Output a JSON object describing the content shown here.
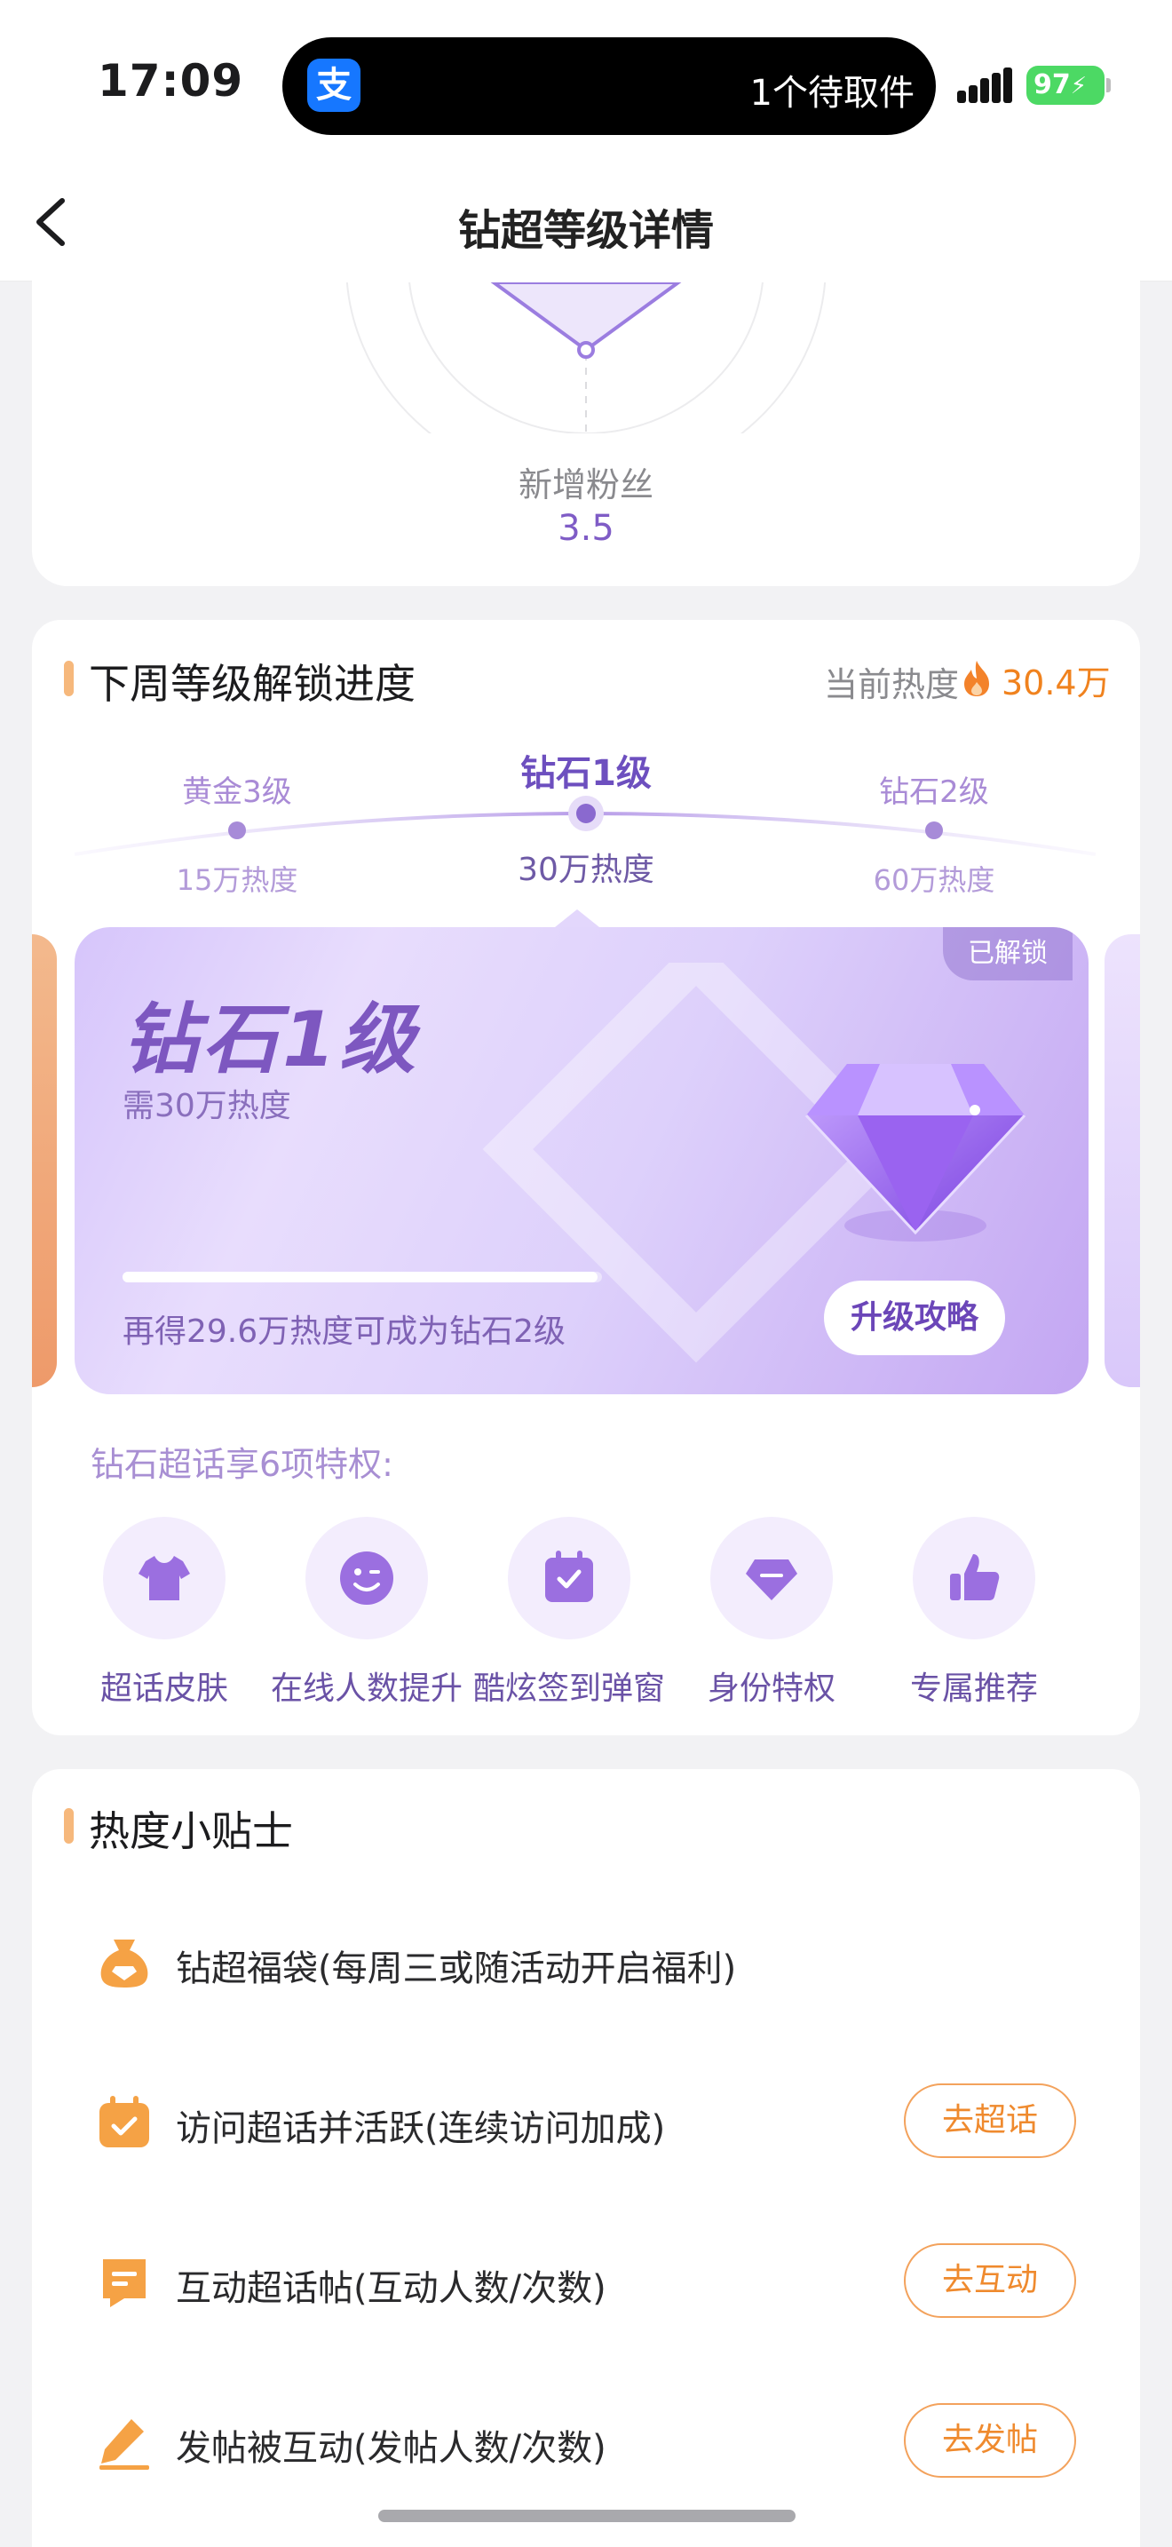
{
  "status_bar": {
    "time": "17:09",
    "app_badge": "支",
    "notification": "1个待取件",
    "battery": "97"
  },
  "nav": {
    "title": "钻超等级详情"
  },
  "radar": {
    "axis_label": "新增粉丝",
    "axis_value": "3.5"
  },
  "unlock_section": {
    "title": "下周等级解锁进度",
    "heat_label": "当前热度",
    "heat_value": "30.4万",
    "timeline": {
      "left": {
        "name": "黄金3级",
        "requirement": "15万热度"
      },
      "current": {
        "name": "钻石1级",
        "requirement": "30万热度"
      },
      "right": {
        "name": "钻石2级",
        "requirement": "60万热度"
      }
    },
    "level_card": {
      "badge": "已解锁",
      "name": "钻石1级",
      "requirement": "需30万热度",
      "progress_fraction": 0.99,
      "tip": "再得29.6万热度可成为钻石2级",
      "guide_button": "升级攻略",
      "accent_color": "#7d57c0"
    },
    "privileges_title": "钻石超话享6项特权:",
    "privileges": [
      {
        "label": "超话皮肤",
        "icon": "tshirt-icon"
      },
      {
        "label": "在线人数提升",
        "icon": "wink-face-icon"
      },
      {
        "label": "酷炫签到弹窗",
        "icon": "calendar-check-icon"
      },
      {
        "label": "身份特权",
        "icon": "diamond-badge-icon"
      },
      {
        "label": "专属推荐",
        "icon": "thumbs-up-icon"
      }
    ]
  },
  "tips_section": {
    "title": "热度小贴士",
    "items": [
      {
        "text": "钻超福袋(每周三或随活动开启福利)",
        "button": "",
        "icon": "lucky-bag-icon"
      },
      {
        "text": "访问超话并活跃(连续访问加成)",
        "button": "去超话",
        "icon": "calendar-check-icon"
      },
      {
        "text": "互动超话帖(互动人数/次数)",
        "button": "去互动",
        "icon": "comment-note-icon"
      },
      {
        "text": "发帖被互动(发帖人数/次数)",
        "button": "去发帖",
        "icon": "pencil-icon"
      }
    ]
  }
}
